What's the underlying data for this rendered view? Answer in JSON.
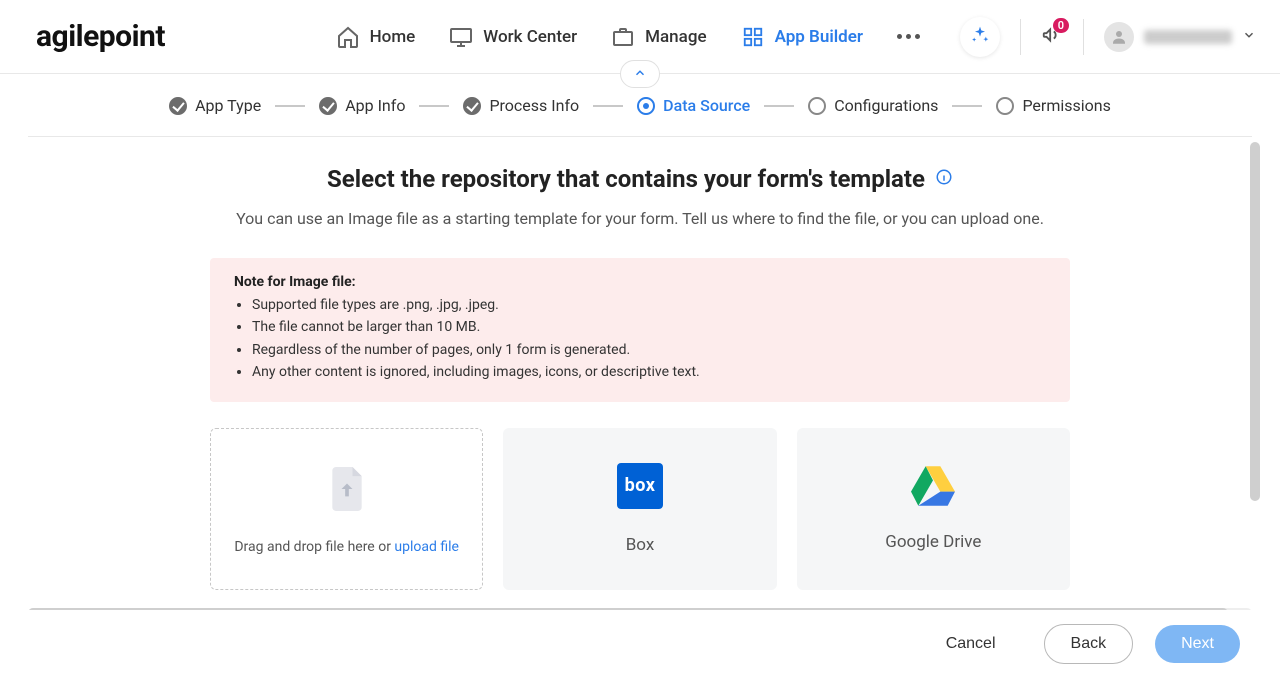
{
  "brand": "agilepoint",
  "nav": {
    "home": "Home",
    "work_center": "Work Center",
    "manage": "Manage",
    "app_builder": "App Builder"
  },
  "notifications_count": "0",
  "stepper": {
    "app_type": "App Type",
    "app_info": "App Info",
    "process_info": "Process Info",
    "data_source": "Data Source",
    "configurations": "Configurations",
    "permissions": "Permissions"
  },
  "page": {
    "title": "Select the repository that contains your form's template",
    "subtitle": "You can use an Image file as a starting template for your form. Tell us where to find the file, or you can upload one."
  },
  "note": {
    "heading": "Note for Image file:",
    "items": [
      "Supported file types are .png, .jpg, .jpeg.",
      "The file cannot be larger than 10 MB.",
      "Regardless of the number of pages, only 1 form is generated.",
      "Any other content is ignored, including images, icons, or descriptive text."
    ]
  },
  "upload": {
    "prefix": "Drag and drop file here or ",
    "link": "upload file"
  },
  "repos": {
    "box": "Box",
    "gdrive": "Google Drive"
  },
  "footer": {
    "cancel": "Cancel",
    "back": "Back",
    "next": "Next"
  }
}
